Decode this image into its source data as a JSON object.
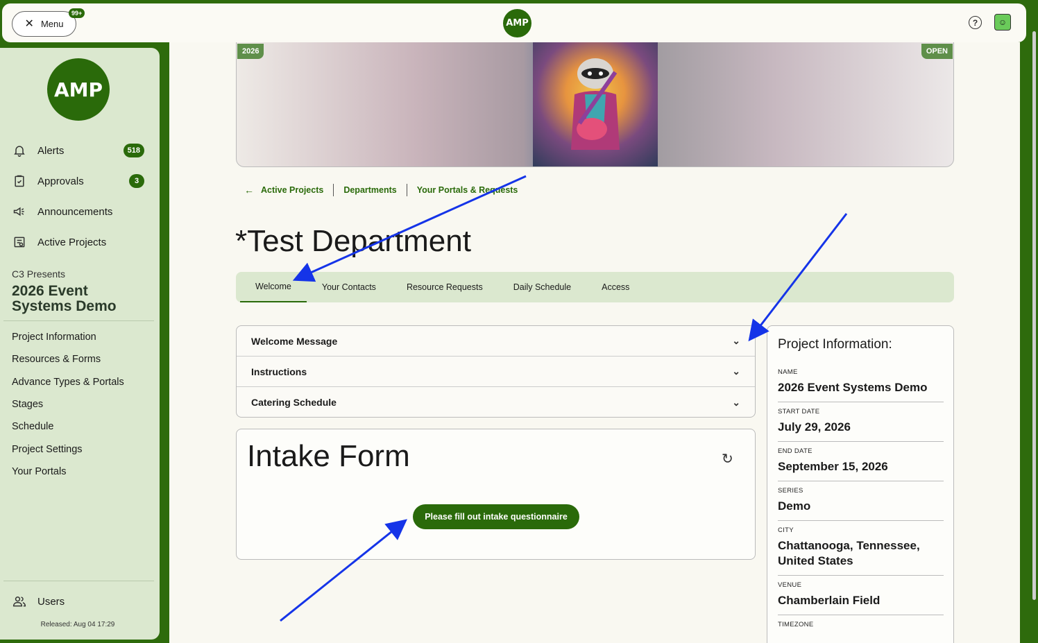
{
  "topbar": {
    "menu_label": "Menu",
    "menu_badge": "99+",
    "logo_text": "AMP"
  },
  "sidebar": {
    "logo_text": "AMP",
    "nav": [
      {
        "label": "Alerts",
        "badge": "518",
        "icon": "bell-icon"
      },
      {
        "label": "Approvals",
        "badge": "3",
        "icon": "clipboard-check-icon"
      },
      {
        "label": "Announcements",
        "icon": "megaphone-icon"
      },
      {
        "label": "Active Projects",
        "icon": "project-list-icon"
      }
    ],
    "org": "C3 Presents",
    "project": "2026 Event Systems Demo",
    "links": [
      "Project Information",
      "Resources & Forms",
      "Advance Types & Portals",
      "Stages",
      "Schedule",
      "Project Settings",
      "Your Portals"
    ],
    "users_label": "Users",
    "release": "Released: Aug 04 17:29"
  },
  "banner": {
    "year": "2026",
    "status": "OPEN"
  },
  "breadcrumbs": [
    "Active Projects",
    "Departments",
    "Your Portals & Requests"
  ],
  "page_title": "*Test Department",
  "tabs": [
    "Welcome",
    "Your Contacts",
    "Resource Requests",
    "Daily Schedule",
    "Access"
  ],
  "accordion": [
    "Welcome Message",
    "Instructions",
    "Catering Schedule"
  ],
  "intake": {
    "title": "Intake Form",
    "button": "Please fill out intake questionnaire"
  },
  "project_info": {
    "heading": "Project Information:",
    "fields": [
      {
        "label": "NAME",
        "value": "2026 Event Systems Demo"
      },
      {
        "label": "START DATE",
        "value": "July 29, 2026"
      },
      {
        "label": "END DATE",
        "value": "September 15, 2026"
      },
      {
        "label": "SERIES",
        "value": "Demo"
      },
      {
        "label": "CITY",
        "value": "Chattanooga, Tennessee, United States"
      },
      {
        "label": "VENUE",
        "value": "Chamberlain Field"
      },
      {
        "label": "TIMEZONE",
        "value": ""
      }
    ]
  },
  "colors": {
    "brand_green": "#2a6a0a",
    "sidebar_bg": "#dbe8cf",
    "annotation_arrow": "#1534e8"
  }
}
